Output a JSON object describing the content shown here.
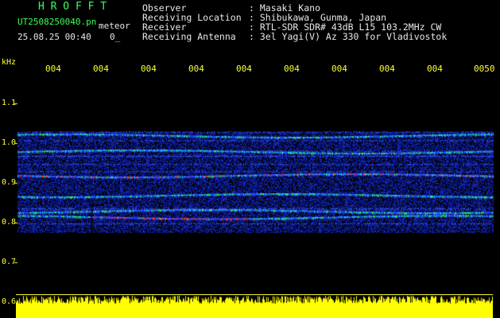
{
  "header": {
    "app_name": "H R O F F T",
    "filename": "UT2508250040.pn",
    "tag": "meteor",
    "datetime": "25.08.25 00:40",
    "dt_extra": "0_",
    "fields": [
      {
        "label": "Observer",
        "value": ": Masaki Kano"
      },
      {
        "label": "Receiving Location",
        "value": ": Shibukawa, Gunma, Japan"
      },
      {
        "label": "Receiver",
        "value": ": RTL-SDR SDR# 43dB L15 103.2MHz CW"
      },
      {
        "label": "Receiving Antenna",
        "value": ": 3el Yagi(V) Az 330 for Vladivostok"
      }
    ]
  },
  "axis": {
    "unit": "kHz",
    "time_ticks": [
      "004",
      "004",
      "004",
      "004",
      "004",
      "004",
      "004",
      "004",
      "004",
      "0050"
    ],
    "freq_ticks": [
      "1.1",
      "1.0",
      "0.9",
      "0.8",
      "0.7",
      "0.6"
    ]
  },
  "colors": {
    "header_green": "#3cff5a",
    "text_white": "#e8e8e8",
    "axis_yellow": "#ffff33",
    "noise_blue": "#1a2ec8",
    "echo_red": "#ff3030",
    "amplitude_yellow": "#ffff00"
  },
  "spectrogram": {
    "freq_min_khz": 0.6,
    "freq_max_khz": 1.2,
    "signal_band_khz": [
      0.775,
      1.03
    ],
    "strong_lines_khz": [
      0.92,
      0.87,
      0.83,
      0.98,
      1.02,
      0.815
    ]
  }
}
